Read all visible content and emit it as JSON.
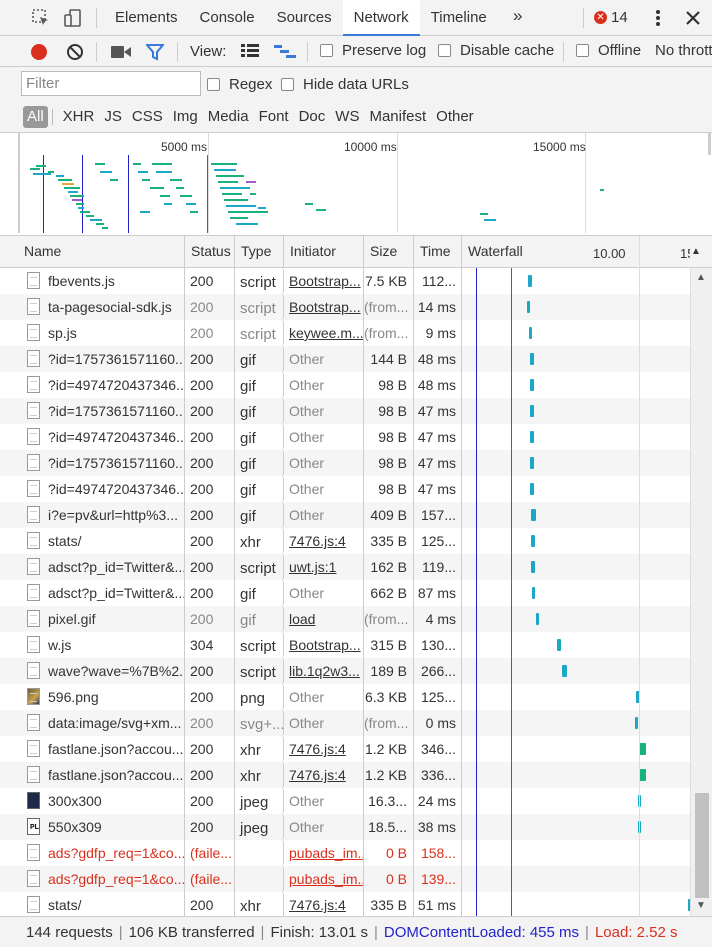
{
  "tabs": [
    "Elements",
    "Console",
    "Sources",
    "Network",
    "Timeline"
  ],
  "active_tab": "Network",
  "more_tabs": "»",
  "error_count": "14",
  "toolbar": {
    "view_label": "View:",
    "preserve_log": "Preserve log",
    "disable_cache": "Disable cache",
    "offline": "Offline",
    "throttle": "No thrott"
  },
  "filter": {
    "placeholder": "Filter",
    "regex": "Regex",
    "hide_data_urls": "Hide data URLs"
  },
  "types": [
    "All",
    "XHR",
    "JS",
    "CSS",
    "Img",
    "Media",
    "Font",
    "Doc",
    "WS",
    "Manifest",
    "Other"
  ],
  "overview": {
    "marks": [
      "5000 ms",
      "10000 ms",
      "15000 ms"
    ]
  },
  "columns": {
    "name": "Name",
    "status": "Status",
    "type": "Type",
    "initiator": "Initiator",
    "size": "Size",
    "time": "Time",
    "waterfall": "Waterfall",
    "wf_tick1": "10.00",
    "wf_tick2": "15"
  },
  "rows": [
    {
      "name": "fbevents.js",
      "status": "200",
      "type": "script",
      "initiator": "Bootstrap...",
      "init_link": true,
      "size": "7.5 KB",
      "time": "112...",
      "icon": "doc",
      "wf": [
        528,
        4,
        "#1ba8c8"
      ]
    },
    {
      "name": "ta-pagesocial-sdk.js",
      "status": "200",
      "type": "script",
      "initiator": "Bootstrap...",
      "init_link": true,
      "size": "(from...",
      "time": "14 ms",
      "icon": "doc",
      "gray": true,
      "wf": [
        527,
        3,
        "#1ba8c8"
      ]
    },
    {
      "name": "sp.js",
      "status": "200",
      "type": "script",
      "initiator": "keywee.m...",
      "init_link": true,
      "size": "(from...",
      "time": "9 ms",
      "icon": "doc",
      "gray": true,
      "wf": [
        529,
        3,
        "#1ba8c8"
      ]
    },
    {
      "name": "?id=1757361571160...",
      "status": "200",
      "type": "gif",
      "initiator": "Other",
      "size": "144 B",
      "time": "48 ms",
      "icon": "doc",
      "wf": [
        530,
        4,
        "#1ba8c8"
      ]
    },
    {
      "name": "?id=4974720437346...",
      "status": "200",
      "type": "gif",
      "initiator": "Other",
      "size": "98 B",
      "time": "48 ms",
      "icon": "doc",
      "wf": [
        530,
        4,
        "#1ba8c8"
      ]
    },
    {
      "name": "?id=1757361571160...",
      "status": "200",
      "type": "gif",
      "initiator": "Other",
      "size": "98 B",
      "time": "47 ms",
      "icon": "doc",
      "wf": [
        530,
        4,
        "#1ba8c8"
      ]
    },
    {
      "name": "?id=4974720437346...",
      "status": "200",
      "type": "gif",
      "initiator": "Other",
      "size": "98 B",
      "time": "47 ms",
      "icon": "doc",
      "wf": [
        530,
        4,
        "#1ba8c8"
      ]
    },
    {
      "name": "?id=1757361571160...",
      "status": "200",
      "type": "gif",
      "initiator": "Other",
      "size": "98 B",
      "time": "47 ms",
      "icon": "doc",
      "wf": [
        530,
        4,
        "#1ba8c8"
      ]
    },
    {
      "name": "?id=4974720437346...",
      "status": "200",
      "type": "gif",
      "initiator": "Other",
      "size": "98 B",
      "time": "47 ms",
      "icon": "doc",
      "wf": [
        530,
        4,
        "#1ba8c8"
      ]
    },
    {
      "name": "i?e=pv&url=http%3...",
      "status": "200",
      "type": "gif",
      "initiator": "Other",
      "size": "409 B",
      "time": "157...",
      "icon": "doc",
      "wf": [
        531,
        5,
        "#1ba8c8"
      ]
    },
    {
      "name": "stats/",
      "status": "200",
      "type": "xhr",
      "initiator": "7476.js:4",
      "init_link": true,
      "size": "335 B",
      "time": "125...",
      "icon": "doc",
      "wf": [
        531,
        4,
        "#1ba8c8"
      ]
    },
    {
      "name": "adsct?p_id=Twitter&...",
      "status": "200",
      "type": "script",
      "initiator": "uwt.js:1",
      "init_link": true,
      "size": "162 B",
      "time": "119...",
      "icon": "doc",
      "wf": [
        531,
        4,
        "#1ba8c8"
      ]
    },
    {
      "name": "adsct?p_id=Twitter&...",
      "status": "200",
      "type": "gif",
      "initiator": "Other",
      "size": "662 B",
      "time": "87 ms",
      "icon": "doc",
      "wf": [
        532,
        3,
        "#1ba8c8"
      ]
    },
    {
      "name": "pixel.gif",
      "status": "200",
      "type": "gif",
      "initiator": "load",
      "init_link": true,
      "size": "(from...",
      "time": "4 ms",
      "icon": "doc",
      "gray": true,
      "wf": [
        536,
        3,
        "#1ba8c8"
      ]
    },
    {
      "name": "w.js",
      "status": "304",
      "type": "script",
      "initiator": "Bootstrap...",
      "init_link": true,
      "size": "315 B",
      "time": "130...",
      "icon": "doc",
      "wf": [
        557,
        4,
        "#1ba8c8"
      ]
    },
    {
      "name": "wave?wave=%7B%2...",
      "status": "200",
      "type": "script",
      "initiator": "lib.1q2w3...",
      "init_link": true,
      "size": "189 B",
      "time": "266...",
      "icon": "doc",
      "wf": [
        562,
        5,
        "#1ba8c8"
      ]
    },
    {
      "name": "596.png",
      "status": "200",
      "type": "png",
      "initiator": "Other",
      "size": "6.3 KB",
      "time": "125...",
      "icon": "png",
      "wf": [
        636,
        4,
        "#1ba8c8"
      ]
    },
    {
      "name": "data:image/svg+xm...",
      "status": "200",
      "type": "svg+...",
      "initiator": "Other",
      "size": "(from...",
      "time": "0 ms",
      "icon": "doc",
      "gray": true,
      "wf": [
        635,
        3,
        "#1ba8c8"
      ]
    },
    {
      "name": "fastlane.json?accou...",
      "status": "200",
      "type": "xhr",
      "initiator": "7476.js:4",
      "init_link": true,
      "size": "1.2 KB",
      "time": "346...",
      "icon": "doc",
      "wf": [
        639,
        7,
        "#19b27a"
      ]
    },
    {
      "name": "fastlane.json?accou...",
      "status": "200",
      "type": "xhr",
      "initiator": "7476.js:4",
      "init_link": true,
      "size": "1.2 KB",
      "time": "336...",
      "icon": "doc",
      "wf": [
        639,
        7,
        "#19b27a"
      ]
    },
    {
      "name": "300x300",
      "status": "200",
      "type": "jpeg",
      "initiator": "Other",
      "size": "16.3...",
      "time": "24 ms",
      "icon": "img",
      "wf": [
        638,
        3,
        "#1ba8c8"
      ]
    },
    {
      "name": "550x309",
      "status": "200",
      "type": "jpeg",
      "initiator": "Other",
      "size": "18.5...",
      "time": "38 ms",
      "icon": "pl",
      "wf": [
        638,
        3,
        "#1ba8c8"
      ]
    },
    {
      "name": "ads?gdfp_req=1&co...",
      "status": "(faile...",
      "type": "",
      "initiator": "pubads_im...",
      "init_link": true,
      "size": "0 B",
      "time": "158...",
      "icon": "doc",
      "red": true
    },
    {
      "name": "ads?gdfp_req=1&co...",
      "status": "(faile...",
      "type": "",
      "initiator": "pubads_im...",
      "init_link": true,
      "size": "0 B",
      "time": "139...",
      "icon": "doc",
      "red": true
    },
    {
      "name": "stats/",
      "status": "200",
      "type": "xhr",
      "initiator": "7476.js:4",
      "init_link": true,
      "size": "335 B",
      "time": "51 ms",
      "icon": "doc",
      "wf": [
        688,
        3,
        "#1ba8c8"
      ]
    }
  ],
  "status": {
    "requests": "144 requests",
    "transferred": "106 KB transferred",
    "finish": "Finish: 13.01 s",
    "dcl": "DOMContentLoaded: 455 ms",
    "load": "Load: 2.52 s"
  },
  "colors": {
    "accent": "#3879d9",
    "record": "#d9301e",
    "dcl": "#2222cc",
    "load": "#d9301e",
    "waiting": "#19b27a",
    "receiving": "#1ba8c8"
  }
}
